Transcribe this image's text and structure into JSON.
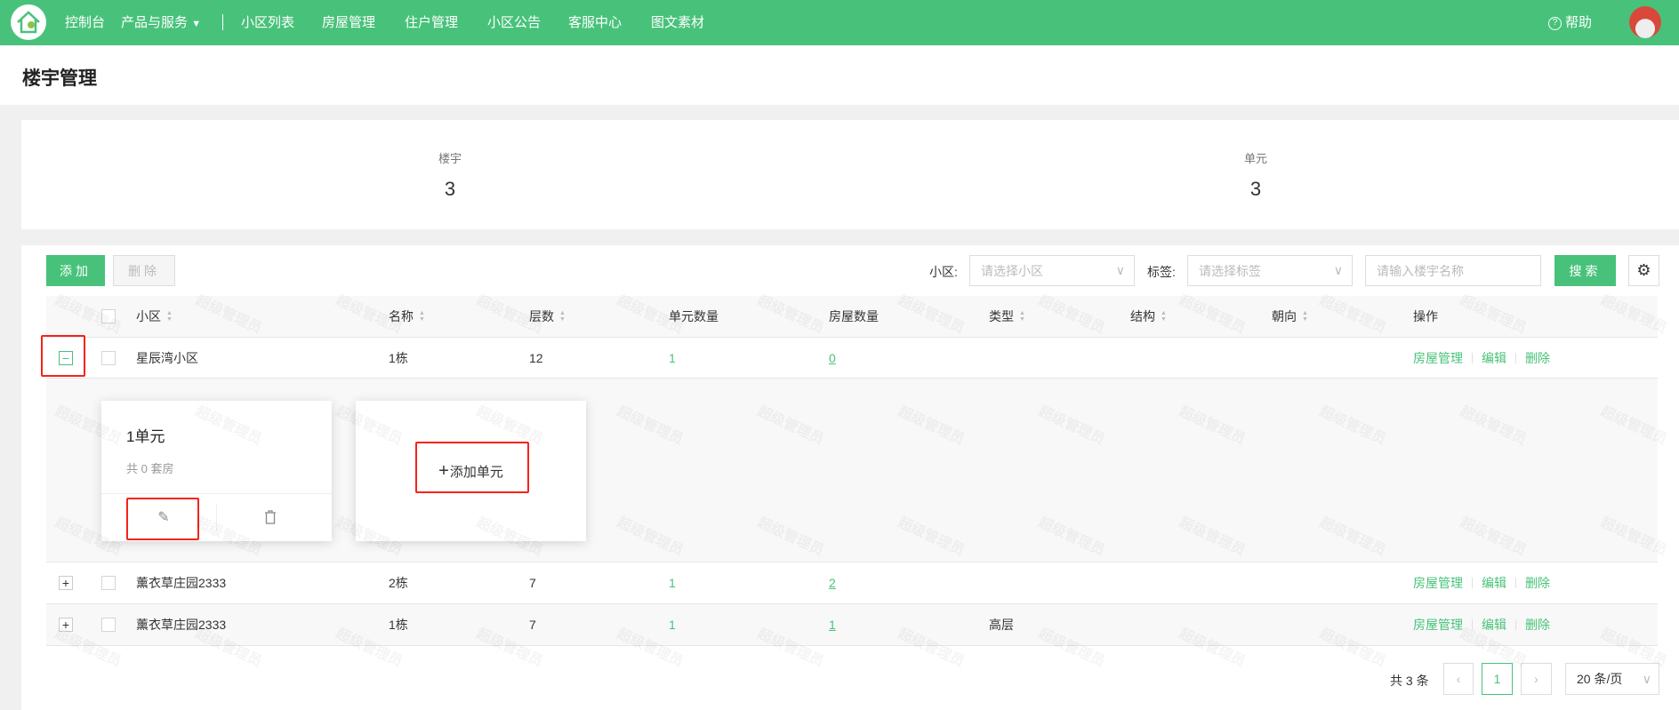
{
  "topbar": {
    "nav": [
      "控制台",
      "产品与服务",
      "小区列表",
      "房屋管理",
      "住户管理",
      "小区公告",
      "客服中心",
      "图文素材"
    ],
    "help": "帮助"
  },
  "page": {
    "title": "楼宇管理"
  },
  "stats": [
    {
      "label": "楼宇",
      "value": "3"
    },
    {
      "label": "单元",
      "value": "3"
    }
  ],
  "toolbar": {
    "add": "添加",
    "delete": "删除",
    "community_label": "小区:",
    "community_placeholder": "请选择小区",
    "tag_label": "标签:",
    "tag_placeholder": "请选择标签",
    "name_placeholder": "请输入楼宇名称",
    "search": "搜索"
  },
  "table": {
    "headers": [
      "小区",
      "名称",
      "层数",
      "单元数量",
      "房屋数量",
      "类型",
      "结构",
      "朝向",
      "操作"
    ],
    "rows": [
      {
        "community": "星辰湾小区",
        "name": "1栋",
        "floors": "12",
        "units": "1",
        "houses": "0",
        "type": "",
        "structure": "",
        "orientation": ""
      },
      {
        "community": "薰衣草庄园2333",
        "name": "2栋",
        "floors": "7",
        "units": "1",
        "houses": "2",
        "type": "",
        "structure": "",
        "orientation": ""
      },
      {
        "community": "薰衣草庄园2333",
        "name": "1栋",
        "floors": "7",
        "units": "1",
        "houses": "1",
        "type": "高层",
        "structure": "",
        "orientation": ""
      }
    ],
    "ops": [
      "房屋管理",
      "编辑",
      "删除"
    ]
  },
  "expanded": {
    "unit_title": "1单元",
    "unit_sub": "共 0 套房",
    "add_unit": "添加单元"
  },
  "pagination": {
    "total": "共 3 条",
    "current": "1",
    "page_size": "20 条/页"
  },
  "watermark": "超级管理员",
  "colors": {
    "brand": "#48c27a",
    "highlight": "#f5221b"
  }
}
